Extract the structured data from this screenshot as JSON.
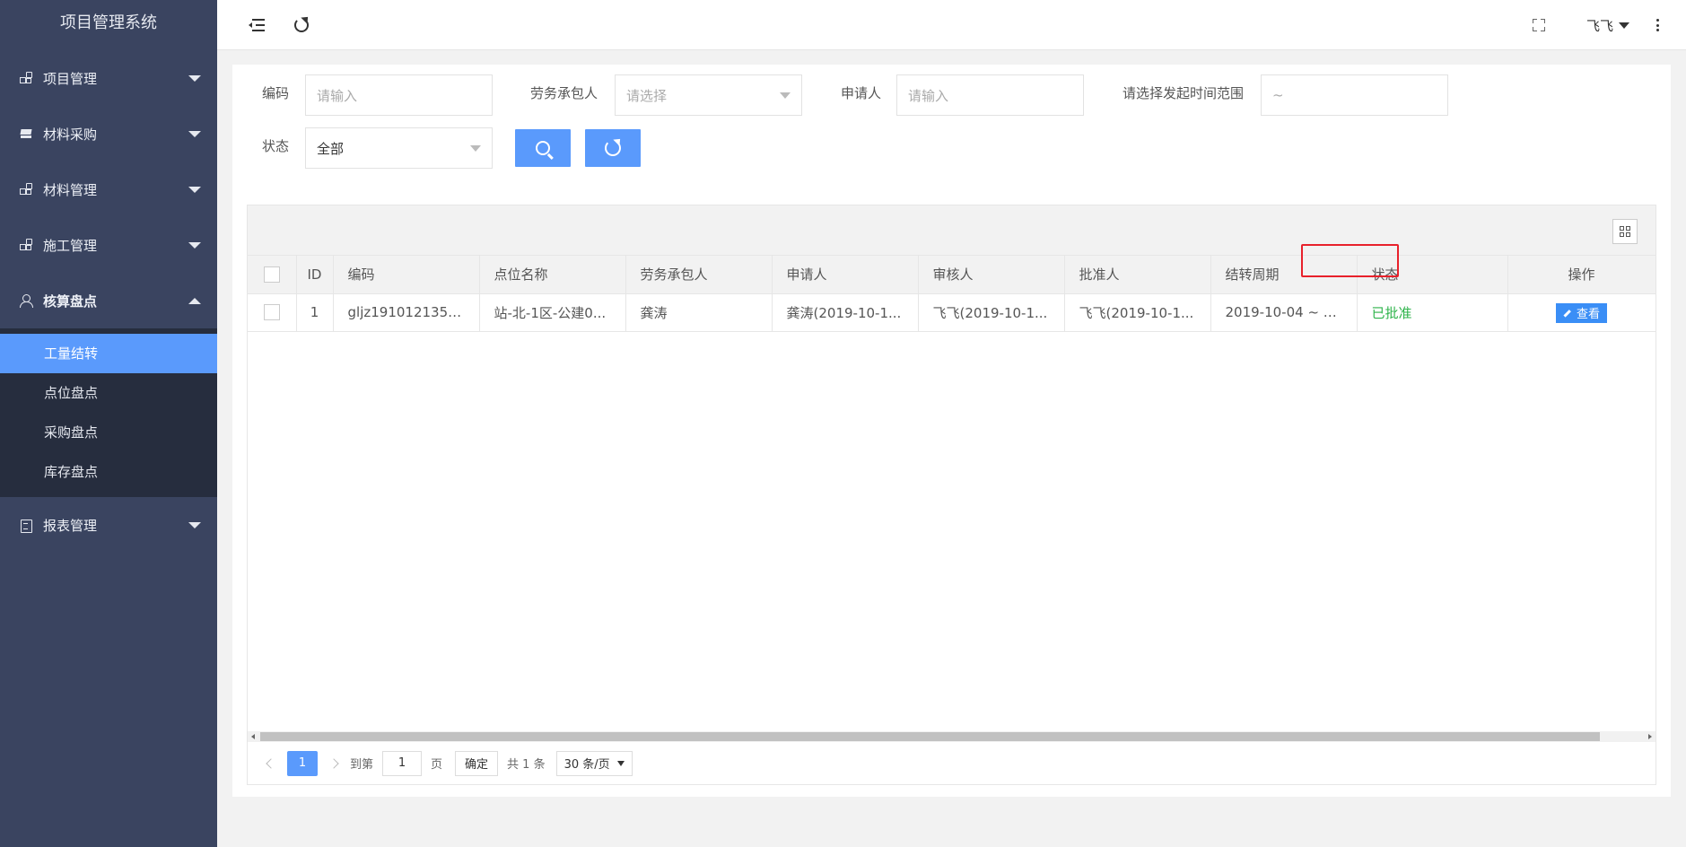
{
  "app": {
    "title": "项目管理系统"
  },
  "sidebar": {
    "items": [
      {
        "label": "项目管理",
        "icon": "grid-icon"
      },
      {
        "label": "材料采购",
        "icon": "layers-icon"
      },
      {
        "label": "材料管理",
        "icon": "grid-icon"
      },
      {
        "label": "施工管理",
        "icon": "grid-icon"
      },
      {
        "label": "核算盘点",
        "icon": "user-icon",
        "expanded": true
      },
      {
        "label": "报表管理",
        "icon": "clipboard-icon"
      }
    ],
    "submenu": [
      {
        "label": "工量结转",
        "active": true
      },
      {
        "label": "点位盘点"
      },
      {
        "label": "采购盘点"
      },
      {
        "label": "库存盘点"
      }
    ],
    "active_color": "#5a9afc"
  },
  "header": {
    "user": "飞飞"
  },
  "filters": {
    "code_label": "编码",
    "code_placeholder": "请输入",
    "contractor_label": "劳务承包人",
    "contractor_placeholder": "请选择",
    "applicant_label": "申请人",
    "applicant_placeholder": "请输入",
    "time_label": "请选择发起时间范围",
    "time_value": "~",
    "status_label": "状态",
    "status_value": "全部"
  },
  "table": {
    "columns": [
      "ID",
      "编码",
      "点位名称",
      "劳务承包人",
      "申请人",
      "审核人",
      "批准人",
      "结转周期",
      "状态",
      "操作"
    ],
    "rows": [
      {
        "id": "1",
        "code": "gljz1910121355...",
        "location": "站-北-1区-公建0...",
        "contractor": "龚涛",
        "applicant": "龚涛(2019-10-1...",
        "reviewer": "飞飞(2019-10-1...",
        "approver": "飞飞(2019-10-1...",
        "period": "2019-10-04 ~ 2...",
        "status": "已批准",
        "action": "查看"
      }
    ],
    "status_color": "#2db34a"
  },
  "pager": {
    "current_page": "1",
    "goto_label": "到第",
    "goto_value": "1",
    "page_unit": "页",
    "confirm_label": "确定",
    "total": "共 1 条",
    "page_size": "30 条/页"
  }
}
